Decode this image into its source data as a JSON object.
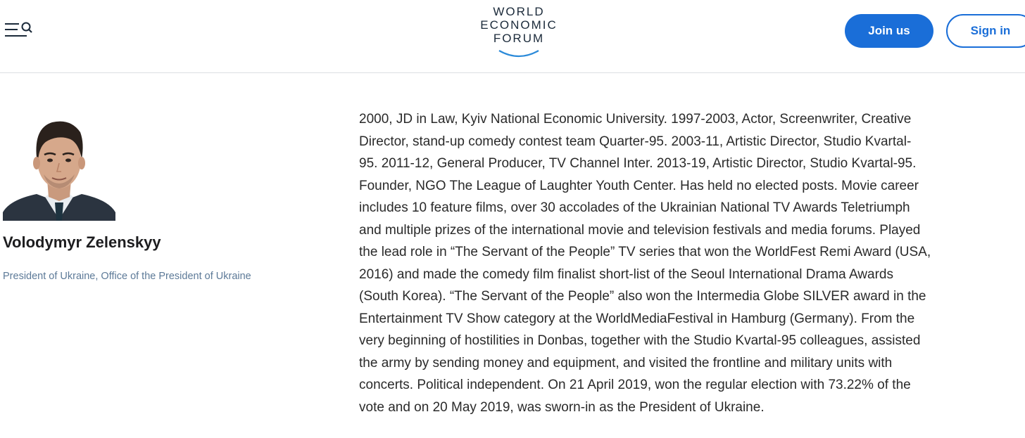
{
  "header": {
    "logo_lines": [
      "WORLD",
      "ECONOMIC",
      "FORUM"
    ],
    "join_label": "Join us",
    "signin_label": "Sign in"
  },
  "profile": {
    "name": "Volodymyr Zelenskyy",
    "role": "President of Ukraine, Office of the President of Ukraine"
  },
  "bio": {
    "text": "2000, JD in Law, Kyiv National Economic University. 1997-2003, Actor, Screenwriter, Creative\nDirector, stand-up comedy contest team Quarter-95. 2003-11, Artistic Director, Studio Kvartal-\n95. 2011-12, General Producer, TV Channel Inter. 2013-19, Artistic Director, Studio Kvartal-95.\nFounder, NGO The League of Laughter Youth Center. Has held no elected posts. Movie career\nincludes 10 feature films, over 30 accolades of the Ukrainian National TV Awards Teletriumph\nand multiple prizes of the international movie and television festivals and media forums. Played\nthe lead role in “The Servant of the People” TV series that won the WorldFest Remi Award (USA,\n2016) and made the comedy film finalist short-list of the Seoul International Drama Awards\n(South Korea). “The Servant of the People” also won the Intermedia Globe SILVER award in the\nEntertainment TV Show category at the WorldMediaFestival in Hamburg (Germany). From the\nvery beginning of hostilities in Donbas, together with the Studio Kvartal-95 colleagues, assisted\nthe army by sending money and equipment, and visited the frontline and military units with\nconcerts. Political independent. On 21 April 2019, won the regular election with 73.22% of the\nvote and on 20 May 2019, was sworn-in as the President of Ukraine."
  },
  "icons": {
    "menu": "menu-icon",
    "search": "search-icon",
    "logo_arc": "logo-arc-icon"
  },
  "colors": {
    "accent": "#1a6ed8",
    "role_text": "#5d7a98",
    "divider": "#dcdfe3"
  }
}
